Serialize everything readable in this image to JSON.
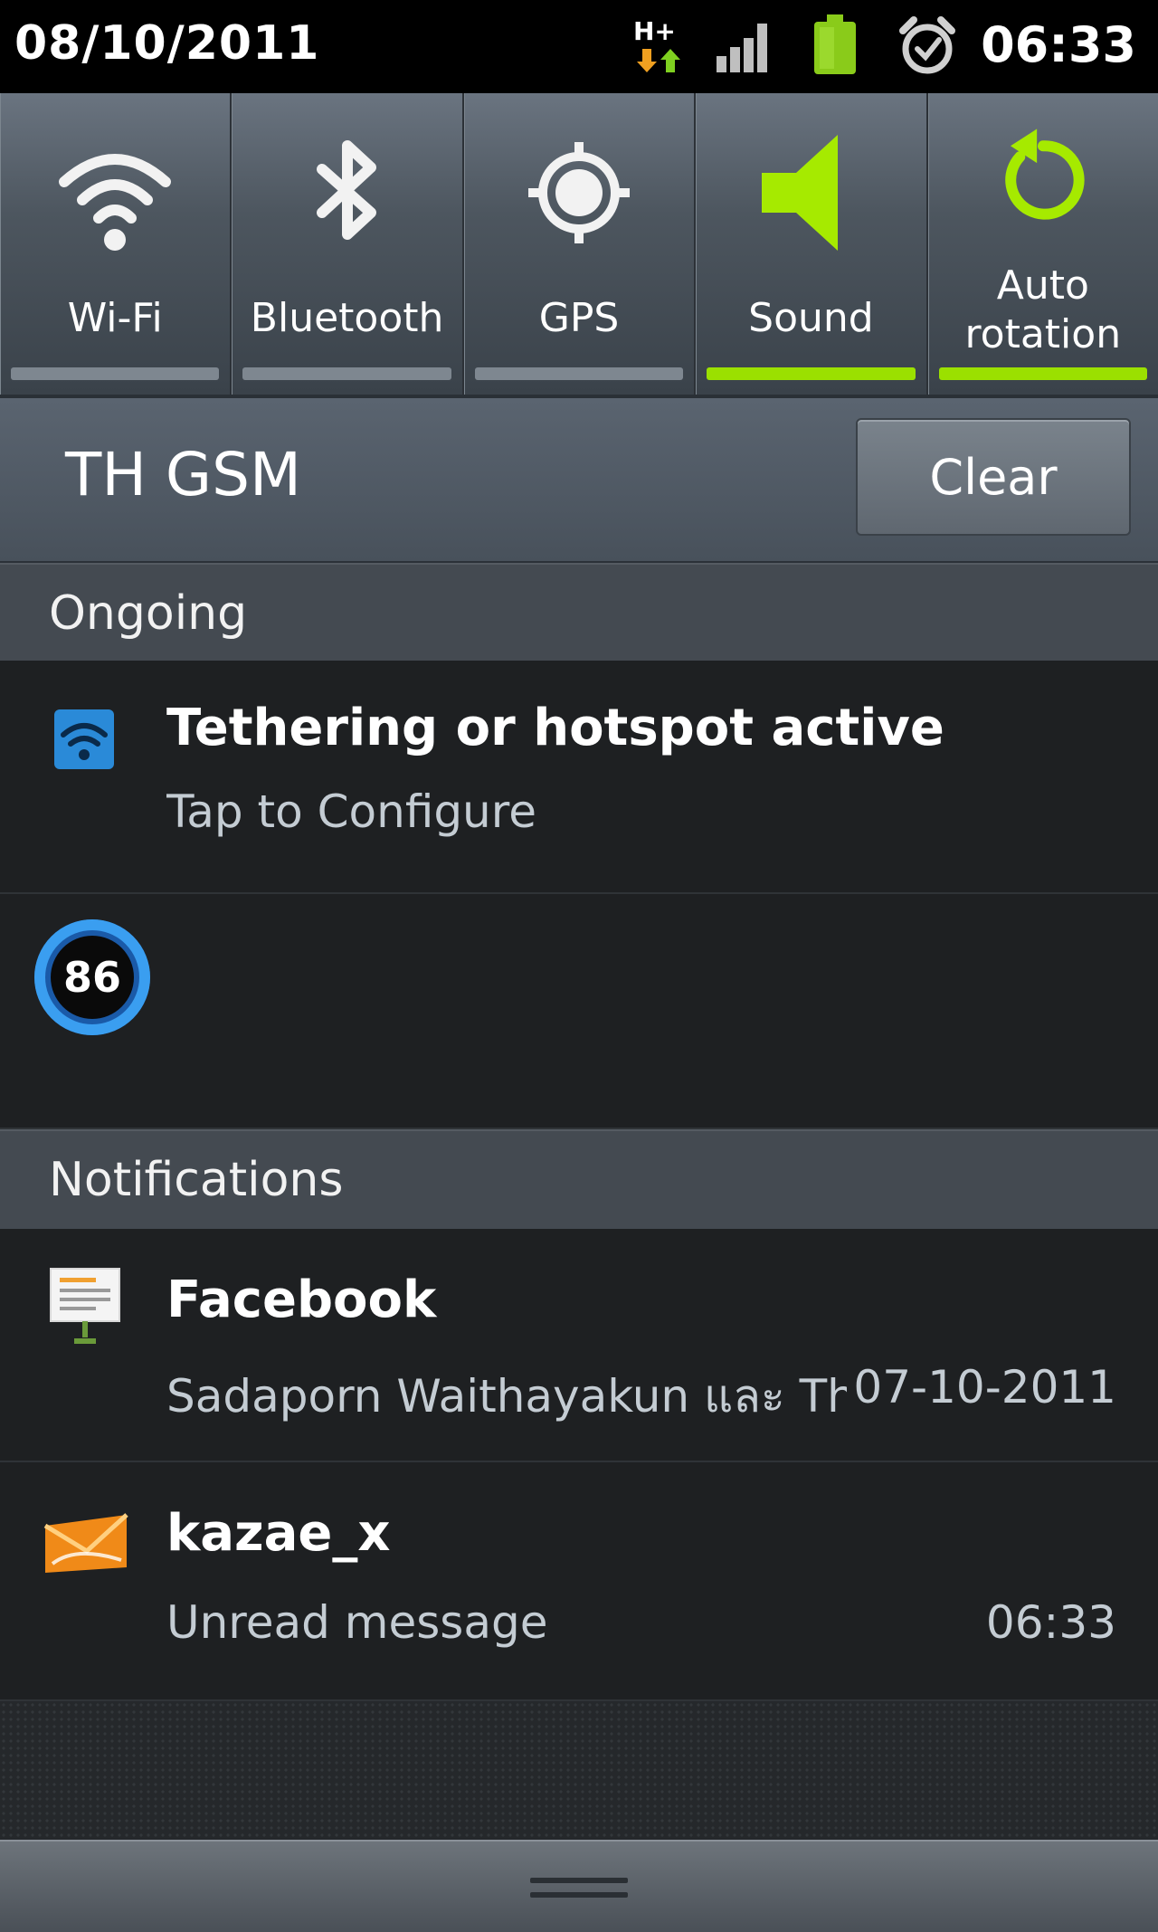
{
  "status_bar": {
    "date": "08/10/2011",
    "time": "06:33",
    "network_type": "H+",
    "icons": [
      "hplus-data-icon",
      "signal-icon",
      "battery-icon",
      "alarm-icon"
    ]
  },
  "quick_toggles": [
    {
      "label": "Wi-Fi",
      "icon": "wifi-icon",
      "active": false
    },
    {
      "label": "Bluetooth",
      "icon": "bluetooth-icon",
      "active": false
    },
    {
      "label": "GPS",
      "icon": "gps-icon",
      "active": false
    },
    {
      "label": "Sound",
      "icon": "speaker-icon",
      "active": true
    },
    {
      "label_line1": "Auto",
      "label_line2": "rotation",
      "icon": "rotate-icon",
      "active": true
    }
  ],
  "carrier": {
    "name": "TH GSM",
    "clear_label": "Clear"
  },
  "ongoing": {
    "header": "Ongoing",
    "items": [
      {
        "title": "Tethering or hotspot active",
        "subtitle": "Tap to Configure",
        "icon": "hotspot-icon"
      },
      {
        "badge": "86",
        "icon": "progress-circle-icon"
      }
    ]
  },
  "notifications": {
    "header": "Notifications",
    "items": [
      {
        "title": "Facebook",
        "subtitle": "Sadaporn Waithayakun และ Th",
        "time": "07-10-2011",
        "icon": "facebook-board-icon"
      },
      {
        "title": "kazae_x",
        "subtitle": "Unread message",
        "time": "06:33",
        "icon": "mail-envelope-icon"
      }
    ]
  },
  "colors": {
    "accent_green": "#9be000",
    "icon_blue": "#2a7fd0",
    "background": "#1e2022"
  }
}
